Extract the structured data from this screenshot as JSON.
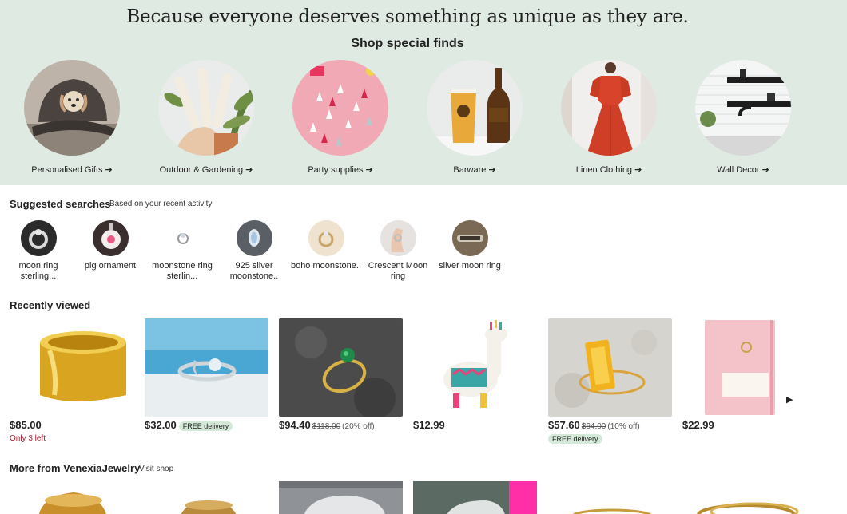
{
  "hero": {
    "title": "Because everyone deserves something as unique as they are.",
    "subtitle": "Shop special finds",
    "background": "#dfeae2",
    "arrow_icon": "arrow-right-icon",
    "categories": [
      {
        "label": "Personalised Gifts"
      },
      {
        "label": "Outdoor & Gardening"
      },
      {
        "label": "Party supplies"
      },
      {
        "label": "Barware"
      },
      {
        "label": "Linen Clothing"
      },
      {
        "label": "Wall Decor"
      }
    ]
  },
  "suggested": {
    "title": "Suggested searches",
    "note": "Based on your recent activity",
    "items": [
      {
        "label": "moon ring sterling..."
      },
      {
        "label": "pig ornament"
      },
      {
        "label": "moonstone ring sterlin..."
      },
      {
        "label": "925 silver moonstone.."
      },
      {
        "label": "boho moonstone.."
      },
      {
        "label": "Crescent Moon ring"
      },
      {
        "label": "silver moon ring"
      }
    ]
  },
  "recent": {
    "title": "Recently viewed",
    "next_icon": "caret-right-icon",
    "items": [
      {
        "price": "$85.00",
        "stock": "Only 3 left"
      },
      {
        "price": "$32.00",
        "badge": "FREE delivery"
      },
      {
        "price": "$94.40",
        "original": "$118.00",
        "discount": "(20% off)"
      },
      {
        "price": "$12.99"
      },
      {
        "price": "$57.60",
        "original": "$64.00",
        "discount": "(10% off)",
        "badge": "FREE delivery"
      },
      {
        "price": "$22.99"
      }
    ]
  },
  "more": {
    "title": "More from VenexiaJewelry",
    "link": "Visit shop"
  },
  "colors": {
    "stock_warning": "#a61a2e",
    "badge_bg": "#d4e9d7"
  }
}
